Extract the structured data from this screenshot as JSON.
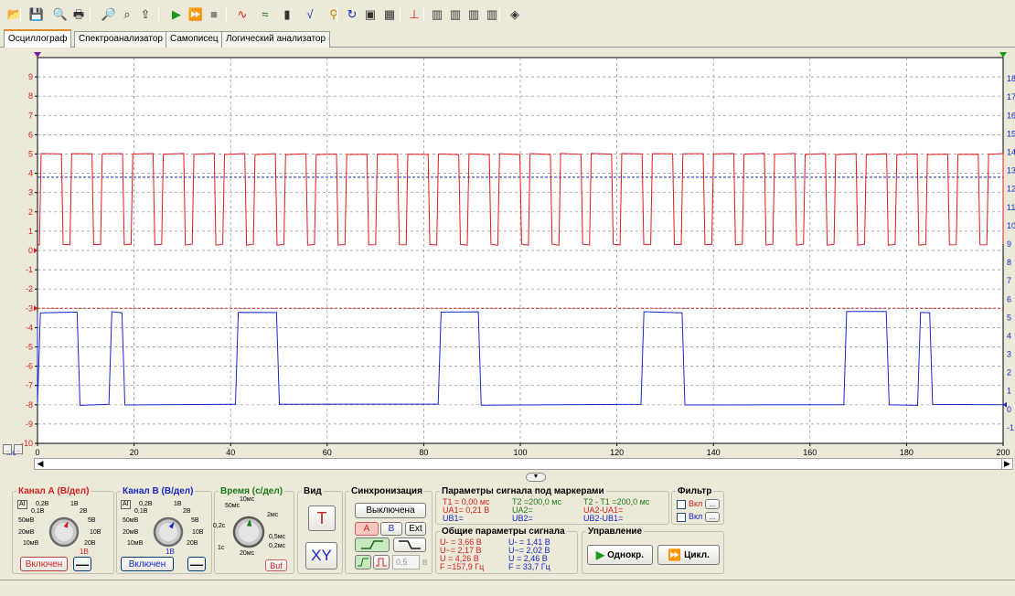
{
  "tabs": [
    {
      "label": "Осциллограф",
      "active": true
    },
    {
      "label": "Спектроанализатор",
      "active": false
    },
    {
      "label": "Самописец",
      "active": false
    },
    {
      "label": "Логический анализатор",
      "active": false
    }
  ],
  "toolbar_icons": [
    "open-folder-icon",
    "save-icon",
    "print-preview-icon",
    "print-icon",
    "zoom-icon",
    "zoom-fit-icon",
    "export-icon",
    "play-icon",
    "fast-forward-icon",
    "stop-icon",
    "waveform-icon",
    "waveform-alt-icon",
    "meter-icon",
    "sqrt-icon",
    "probe-icon",
    "refresh-icon",
    "screenshot-icon",
    "calculator-icon",
    "trigger-marker-icon",
    "chip-1-icon",
    "chip-2-icon",
    "chip-3-icon",
    "chip-4-icon",
    "eraser-icon"
  ],
  "chart_data": {
    "type": "line",
    "x_unit": "мс",
    "xlim": [
      0,
      200
    ],
    "x_ticks": [
      0,
      20,
      40,
      60,
      80,
      100,
      120,
      140,
      160,
      180,
      200
    ],
    "y_left_lim": [
      -10,
      10
    ],
    "y_left_ticks": [
      "9",
      "8",
      "7",
      "6",
      "5",
      "4",
      "3",
      "2",
      "1",
      "0",
      "-1",
      "-2",
      "-3",
      "-4",
      "-5",
      "-6",
      "-7",
      "-8",
      "-9",
      "-10"
    ],
    "y_right_ticks": [
      "18",
      "17",
      "16",
      "15",
      "14",
      "13",
      "12",
      "11",
      "10",
      "9",
      "8",
      "7",
      "6",
      "5",
      "4",
      "3",
      "2",
      "1",
      "0",
      "-1"
    ],
    "grid": true,
    "series": [
      {
        "channel": "A",
        "color": "#e0191e",
        "high": 5.0,
        "low": 0.3,
        "period_ms": 6.33,
        "duty": 0.72,
        "x_start": 0.4
      },
      {
        "channel": "B",
        "color": "#1727c8",
        "high": -3.2,
        "low": -8.0,
        "high_intervals": [
          [
            0,
            8.2
          ],
          [
            14.8,
            17.5
          ],
          [
            41,
            49.5
          ],
          [
            83,
            91.3
          ],
          [
            125,
            133.5
          ],
          [
            167,
            175.8
          ],
          [
            182.3,
            184.8
          ]
        ]
      }
    ],
    "blue_dotted_level": 3.8,
    "red_dotted_level": -3.0
  },
  "channel_a": {
    "title": "Канал А (В/дел)",
    "scale_labels": [
      "0,2В",
      "1В",
      "0,1В",
      "2В",
      "50мВ",
      "5В",
      "20мВ",
      "10В",
      "10мВ",
      "20В"
    ],
    "selected": "1В",
    "enable_label": "Включен",
    "color": "#e0191e"
  },
  "channel_b": {
    "title": "Канал В (В/дел)",
    "scale_labels": [
      "0,2В",
      "1В",
      "0,1В",
      "2В",
      "50мВ",
      "5В",
      "20мВ",
      "10В",
      "10мВ",
      "20В"
    ],
    "selected": "1В",
    "enable_label": "Включен",
    "color": "#1727c8"
  },
  "time": {
    "title": "Время (с/дел)",
    "scale_labels": [
      "50мс",
      "10мс",
      "2мс",
      "0,2с",
      "0,5мс",
      "1с",
      "0,2мс",
      "20мс"
    ],
    "buf_label": "Buf"
  },
  "view": {
    "title": "Вид",
    "t_label": "T",
    "xy_label": "XY"
  },
  "sync": {
    "title": "Синхронизация",
    "mode_label": "Выключена",
    "src_a": "A",
    "src_b": "B",
    "src_ext": "Ext",
    "level_value": "0,5",
    "level_unit": "В"
  },
  "marker_params": {
    "title": "Параметры сигнала под маркерами",
    "col1": [
      "T1 = 0,00 мс",
      "UA1= 0,21 В",
      "UB1="
    ],
    "col2": [
      "T2 =200,0 мс",
      "UA2=",
      "UB2="
    ],
    "col3": [
      "T2 - T1 =200,0 мс",
      "UA2-UA1=",
      "UB2-UB1="
    ]
  },
  "general_params": {
    "title": "Общие параметры сигнала",
    "a": [
      "U- = 3,66 В",
      "U~= 2,17 В",
      "U = 4,26 В",
      "F =157,9 Гц"
    ],
    "b": [
      "U- = 1,41 В",
      "U~= 2,02 В",
      "U = 2,46 В",
      "F = 33,7 Гц"
    ]
  },
  "control": {
    "title": "Управление",
    "single_label": "Однокр.",
    "cycle_label": "Цикл."
  },
  "filter": {
    "title": "Фильтр",
    "row1": "Вкл",
    "row2": "Вкл",
    "dots": "..."
  },
  "axis_unit": "мс"
}
